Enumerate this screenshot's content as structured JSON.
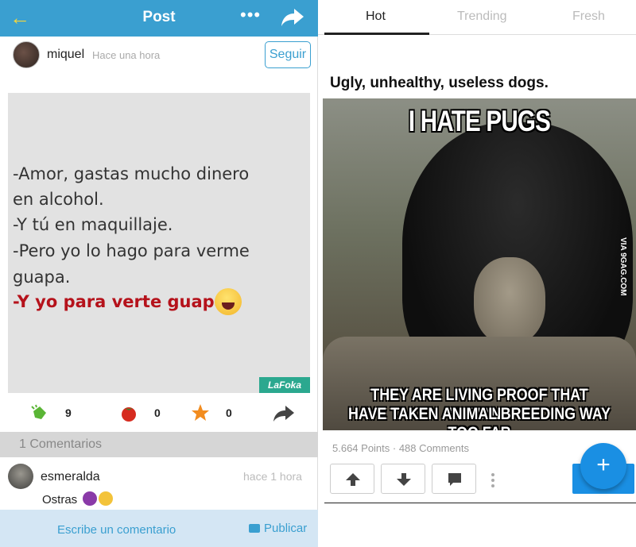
{
  "left": {
    "header": {
      "title": "Post",
      "back_icon": "back-arrow-icon",
      "more_icon": "more-dots-icon",
      "share_icon": "share-icon"
    },
    "author": {
      "name": "miquel",
      "time": "Hace una hora",
      "follow_label": "Seguir"
    },
    "meme": {
      "lines": [
        "-Amor, gastas mucho dinero",
        " en alcohol.",
        "-Y tú en maquillaje.",
        "-Pero yo lo hago para verme",
        " guapa."
      ],
      "punchline": "-Y yo para verte guapa",
      "watermark": "LaFoka"
    },
    "reactions": [
      {
        "icon": "clapping-hands-icon",
        "count": "9"
      },
      {
        "icon": "tomato-icon",
        "count": "0"
      },
      {
        "icon": "star-icon",
        "count": "0"
      }
    ],
    "comments_header": "1 Comentarios",
    "comment": {
      "user": "esmeralda",
      "time": "hace 1 hora",
      "text": "Ostras"
    },
    "compose": {
      "placeholder": "Escribe un comentario",
      "publish_label": "Publicar"
    }
  },
  "right": {
    "tabs": [
      {
        "label": "Hot",
        "active": true
      },
      {
        "label": "Trending",
        "active": false
      },
      {
        "label": "Fresh",
        "active": false
      }
    ],
    "post": {
      "title": "Ugly, unhealthy, useless dogs.",
      "meme_top": "I HATE PUGS",
      "meme_bottom_1": "THEY ARE LIVING PROOF THAT HUMANS",
      "meme_bottom_2": "HAVE TAKEN ANIMAL BREEDING WAY TOO FAR",
      "watermark": "VIA 9GAG.COM",
      "stats": "5.664 Points · 488 Comments"
    },
    "fab_label": "+",
    "colors": {
      "accent": "#1a8fe3",
      "header": "#3a9fd0"
    }
  }
}
